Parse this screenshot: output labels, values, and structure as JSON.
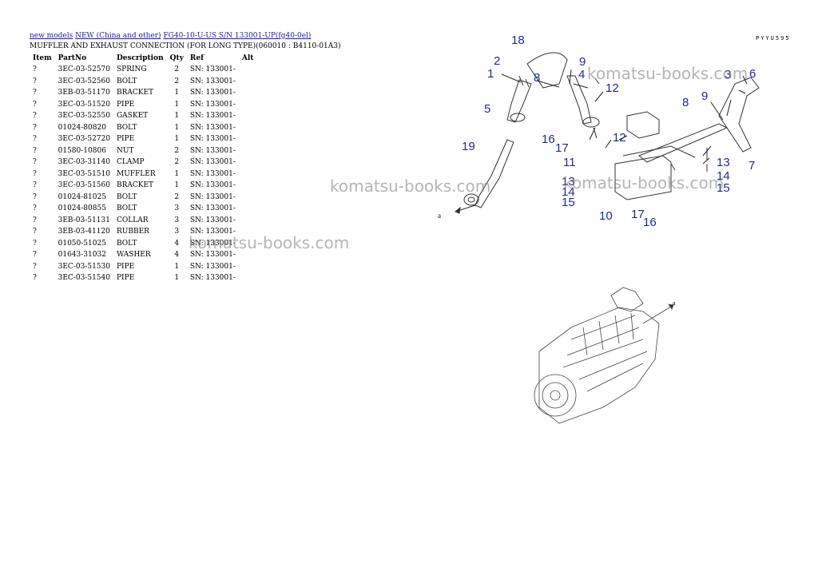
{
  "breadcrumb": {
    "links": [
      "new models",
      "NEW (China and other)",
      "FG40-10-U-US S/N 133001-UP(fg40-0el)"
    ]
  },
  "subtitle": "MUFFLER AND EXHAUST CONNECTION (FOR LONG TYPE)(060010 : B4110-01A3)",
  "corner_code": "PYYU595",
  "table": {
    "headers": [
      "Item",
      "PartNo",
      "Description",
      "Qty",
      "Ref",
      "Alt"
    ],
    "rows": [
      [
        "?",
        "3EC-03-52570",
        "SPRING",
        "2",
        "SN: 133001-",
        ""
      ],
      [
        "?",
        "3EC-03-52560",
        "BOLT",
        "2",
        "SN: 133001-",
        ""
      ],
      [
        "?",
        "3EB-03-51170",
        "BRACKET",
        "1",
        "SN: 133001-",
        ""
      ],
      [
        "?",
        "3EC-03-51520",
        "PIPE",
        "1",
        "SN: 133001-",
        ""
      ],
      [
        "?",
        "3EC-03-52550",
        "GASKET",
        "1",
        "SN: 133001-",
        ""
      ],
      [
        "?",
        "01024-80820",
        "BOLT",
        "1",
        "SN: 133001-",
        ""
      ],
      [
        "?",
        "3EC-03-52720",
        "PIPE",
        "1",
        "SN: 133001-",
        ""
      ],
      [
        "?",
        "01580-10806",
        "NUT",
        "2",
        "SN: 133001-",
        ""
      ],
      [
        "?",
        "3EC-03-31140",
        "CLAMP",
        "2",
        "SN: 133001-",
        ""
      ],
      [
        "?",
        "3EC-03-51510",
        "MUFFLER",
        "1",
        "SN: 133001-",
        ""
      ],
      [
        "?",
        "3EC-03-51560",
        "BRACKET",
        "1",
        "SN: 133001-",
        ""
      ],
      [
        "?",
        "01024-81025",
        "BOLT",
        "2",
        "SN: 133001-",
        ""
      ],
      [
        "?",
        "01024-80855",
        "BOLT",
        "3",
        "SN: 133001-",
        ""
      ],
      [
        "?",
        "3EB-03-51131",
        "COLLAR",
        "3",
        "SN: 133001-",
        ""
      ],
      [
        "?",
        "3EB-03-41120",
        "RUBBER",
        "3",
        "SN: 133001-",
        ""
      ],
      [
        "?",
        "01050-51025",
        "BOLT",
        "4",
        "SN: 133001-",
        ""
      ],
      [
        "?",
        "01643-31032",
        "WASHER",
        "4",
        "SN: 133001-",
        ""
      ],
      [
        "?",
        "3EC-03-51530",
        "PIPE",
        "1",
        "SN: 133001-",
        ""
      ],
      [
        "?",
        "3EC-03-51540",
        "PIPE",
        "1",
        "SN: 133001-",
        ""
      ]
    ]
  },
  "watermark": "komatsu-books.com",
  "diagram": {
    "callouts": [
      "18",
      "2",
      "1",
      "8",
      "9",
      "4",
      "5",
      "12",
      "19",
      "16",
      "17",
      "11",
      "12",
      "13",
      "14",
      "15",
      "10",
      "17",
      "16",
      "3",
      "6",
      "8",
      "9",
      "13",
      "14",
      "15",
      "7"
    ],
    "ref_letter": "a"
  },
  "colors": {
    "callout": "#1f2a8a",
    "link": "#1a1aa6",
    "watermark": "#787878"
  }
}
